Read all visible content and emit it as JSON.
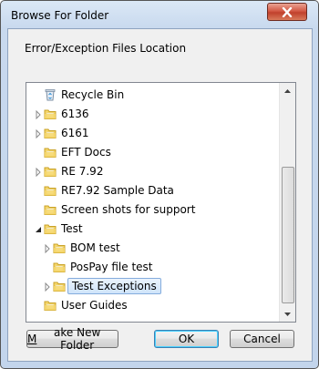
{
  "window": {
    "title": "Browse For Folder"
  },
  "dialog": {
    "description": "Error/Exception Files Location"
  },
  "tree": {
    "items": [
      {
        "label": "Recycle Bin",
        "icon": "recycle-bin-icon",
        "expander": "none",
        "level": 0
      },
      {
        "label": "6136",
        "icon": "folder-icon",
        "expander": "collapsed",
        "level": 0
      },
      {
        "label": "6161",
        "icon": "folder-icon",
        "expander": "collapsed",
        "level": 0
      },
      {
        "label": "EFT Docs",
        "icon": "folder-icon",
        "expander": "none",
        "level": 0
      },
      {
        "label": "RE 7.92",
        "icon": "folder-icon",
        "expander": "collapsed",
        "level": 0
      },
      {
        "label": "RE7.92 Sample Data",
        "icon": "folder-icon",
        "expander": "none",
        "level": 0
      },
      {
        "label": "Screen shots for support",
        "icon": "folder-icon",
        "expander": "none",
        "level": 0
      },
      {
        "label": "Test",
        "icon": "folder-icon",
        "expander": "expanded",
        "level": 0
      },
      {
        "label": "BOM test",
        "icon": "folder-icon",
        "expander": "collapsed",
        "level": 1
      },
      {
        "label": "PosPay file test",
        "icon": "folder-icon",
        "expander": "none",
        "level": 1
      },
      {
        "label": "Test Exceptions",
        "icon": "folder-icon",
        "expander": "collapsed",
        "level": 1,
        "selected": true
      },
      {
        "label": "User Guides",
        "icon": "folder-icon",
        "expander": "none",
        "level": 0
      }
    ]
  },
  "buttons": {
    "make_new_folder": {
      "mnemonic": "M",
      "rest": "ake New Folder"
    },
    "ok": "OK",
    "cancel": "Cancel"
  },
  "colors": {
    "folder_fill": "#f6d76b",
    "folder_edge": "#c9a227",
    "selection_border": "#84acdd",
    "close_button": "#c7432e"
  }
}
